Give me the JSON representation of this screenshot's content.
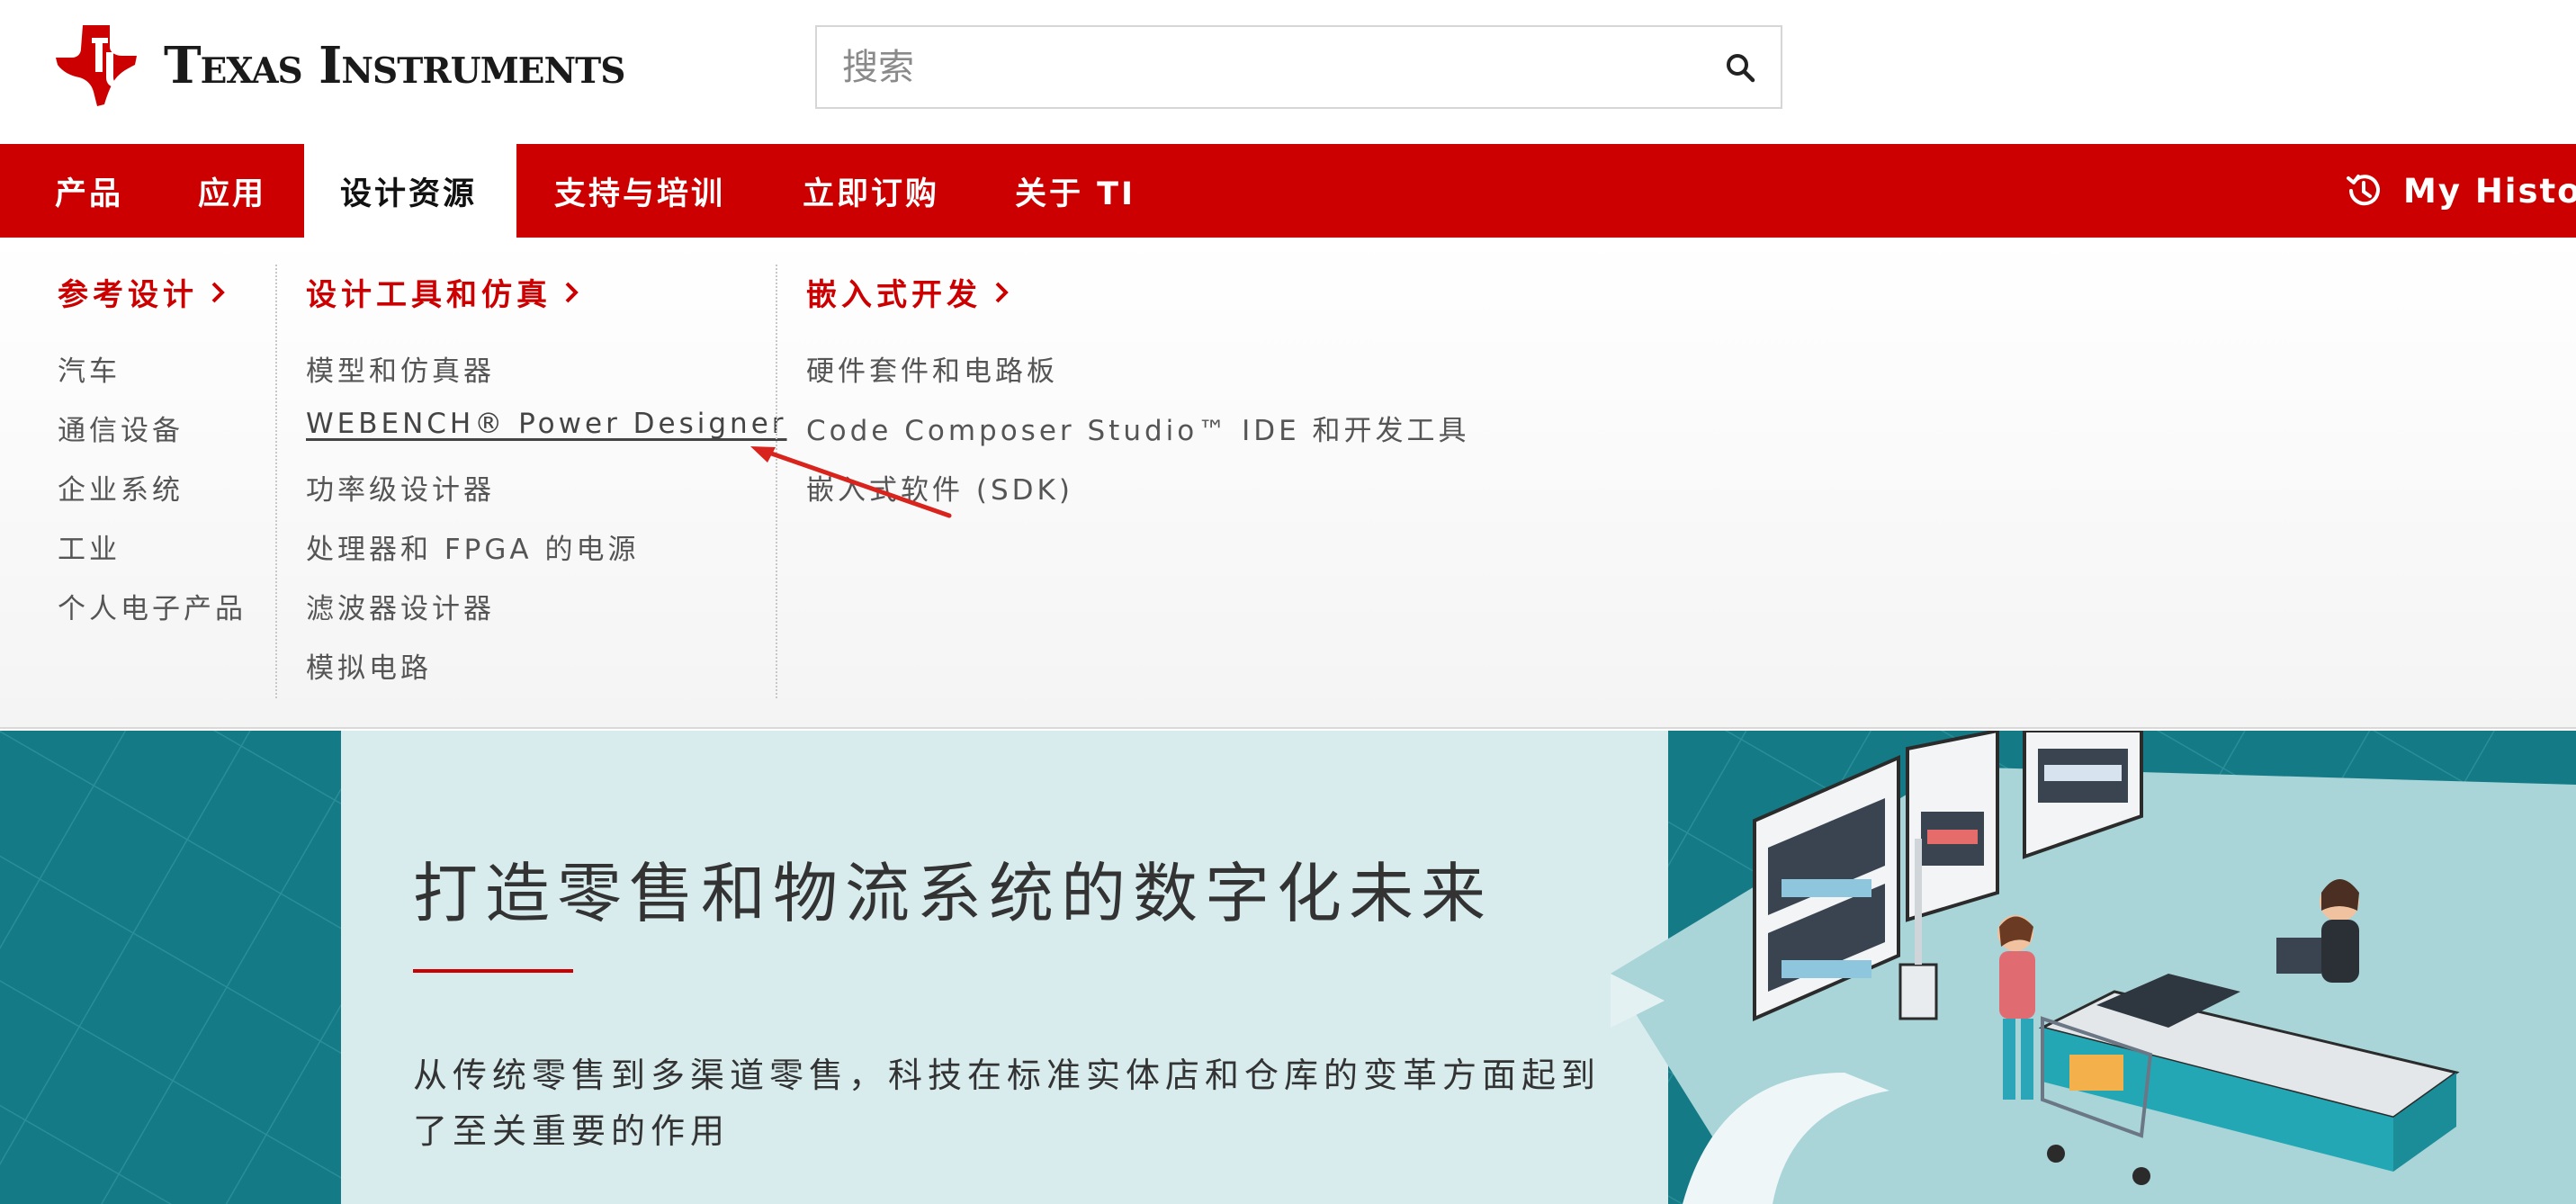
{
  "header": {
    "logo_text": "Texas Instruments",
    "search_placeholder": "搜索",
    "search_icon": "search-icon"
  },
  "nav": {
    "items": [
      {
        "label": "产品"
      },
      {
        "label": "应用"
      },
      {
        "label": "设计资源",
        "active": true
      },
      {
        "label": "支持与培训"
      },
      {
        "label": "立即订购"
      },
      {
        "label": "关于 TI"
      }
    ],
    "history_label": "My History",
    "history_icon": "history-icon"
  },
  "mega_menu": {
    "columns": [
      {
        "heading": "参考设计",
        "links": [
          "汽车",
          "通信设备",
          "企业系统",
          "工业",
          "个人电子产品"
        ]
      },
      {
        "heading": "设计工具和仿真",
        "links": [
          "模型和仿真器",
          "WEBENCH® Power Designer",
          "功率级设计器",
          "处理器和 FPGA 的电源",
          "滤波器设计器",
          "模拟电路"
        ]
      },
      {
        "heading": "嵌入式开发",
        "links": [
          "硬件套件和电路板",
          "Code Composer Studio™ IDE 和开发工具",
          "嵌入式软件 (SDK)"
        ]
      }
    ]
  },
  "hero": {
    "title": "打造零售和物流系统的数字化未来",
    "body": "从传统零售到多渠道零售，科技在标准实体店和仓库的变革方面起到了至关重要的作用"
  },
  "colors": {
    "brand_red": "#cc0000",
    "hero_teal": "#147a86",
    "hero_card": "#d8ecee"
  }
}
